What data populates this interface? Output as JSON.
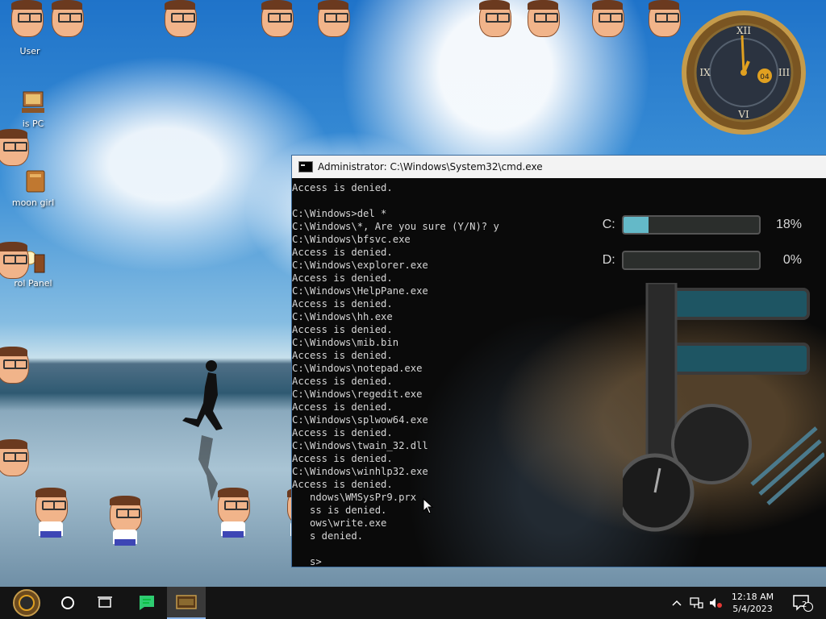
{
  "desktop": {
    "icons": [
      {
        "label": "User",
        "icon": "user-folder-icon"
      },
      {
        "label": "is PC",
        "icon": "computer-icon"
      },
      {
        "label": "moon girl",
        "icon": "folder-icon"
      },
      {
        "label": "rol Panel",
        "icon": "control-panel-icon"
      }
    ]
  },
  "cmd": {
    "title": "Administrator: C:\\Windows\\System32\\cmd.exe",
    "lines": [
      "Access is denied.",
      "",
      "C:\\Windows>del *",
      "C:\\Windows\\*, Are you sure (Y/N)? y",
      "C:\\Windows\\bfsvc.exe",
      "Access is denied.",
      "C:\\Windows\\explorer.exe",
      "Access is denied.",
      "C:\\Windows\\HelpPane.exe",
      "Access is denied.",
      "C:\\Windows\\hh.exe",
      "Access is denied.",
      "C:\\Windows\\mib.bin",
      "Access is denied.",
      "C:\\Windows\\notepad.exe",
      "Access is denied.",
      "C:\\Windows\\regedit.exe",
      "Access is denied.",
      "C:\\Windows\\splwow64.exe",
      "Access is denied.",
      "C:\\Windows\\twain_32.dll",
      "Access is denied.",
      "C:\\Windows\\winhlp32.exe",
      "Access is denied.",
      "   ndows\\WMSysPr9.prx",
      "   ss is denied.",
      "   ows\\write.exe",
      "   s denied.",
      "",
      "   s>"
    ]
  },
  "widget": {
    "drives": [
      {
        "letter": "C:",
        "percent_label": "18%",
        "fill": 0.18
      },
      {
        "letter": "D:",
        "percent_label": "0%",
        "fill": 0.0
      }
    ],
    "clock_numerals": [
      "XII",
      "III",
      "VI",
      "IX"
    ],
    "clock_day": "04"
  },
  "taskbar": {
    "time": "12:18 AM",
    "date": "5/4/2023",
    "notification_count": "2",
    "buttons": [
      "start-button",
      "cortana-button",
      "task-view-button",
      "app-button",
      "cmd-taskbar-button"
    ],
    "tray": [
      "chevron-up-icon",
      "network-icon",
      "volume-muted-icon"
    ]
  },
  "colors": {
    "taskbar": "#141414",
    "console_text": "#d6d6d6",
    "gauge_fill": "#64b9c8"
  }
}
